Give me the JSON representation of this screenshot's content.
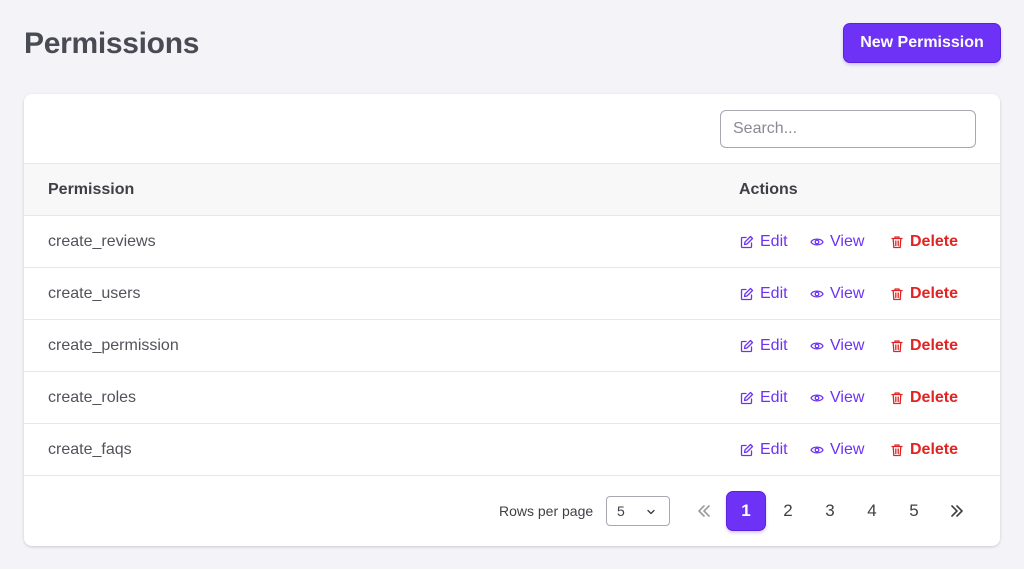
{
  "header": {
    "title": "Permissions",
    "new_button_label": "New Permission"
  },
  "search": {
    "placeholder": "Search...",
    "value": ""
  },
  "table": {
    "columns": [
      "Permission",
      "Actions"
    ],
    "rows": [
      {
        "name": "create_reviews"
      },
      {
        "name": "create_users"
      },
      {
        "name": "create_permission"
      },
      {
        "name": "create_roles"
      },
      {
        "name": "create_faqs"
      }
    ],
    "actions": {
      "edit": "Edit",
      "view": "View",
      "delete": "Delete"
    }
  },
  "pagination": {
    "rows_per_page_label": "Rows per page",
    "rows_per_page_value": "5",
    "pages": [
      "1",
      "2",
      "3",
      "4",
      "5"
    ],
    "current_page": "1"
  },
  "colors": {
    "accent": "#6d32f5",
    "danger": "#e02424",
    "background": "#f4f4f8"
  },
  "icons": {
    "edit": "edit-icon",
    "view": "eye-icon",
    "delete": "trash-icon",
    "first": "double-chevron-left-icon",
    "last": "double-chevron-right-icon",
    "select": "chevron-down-icon"
  }
}
